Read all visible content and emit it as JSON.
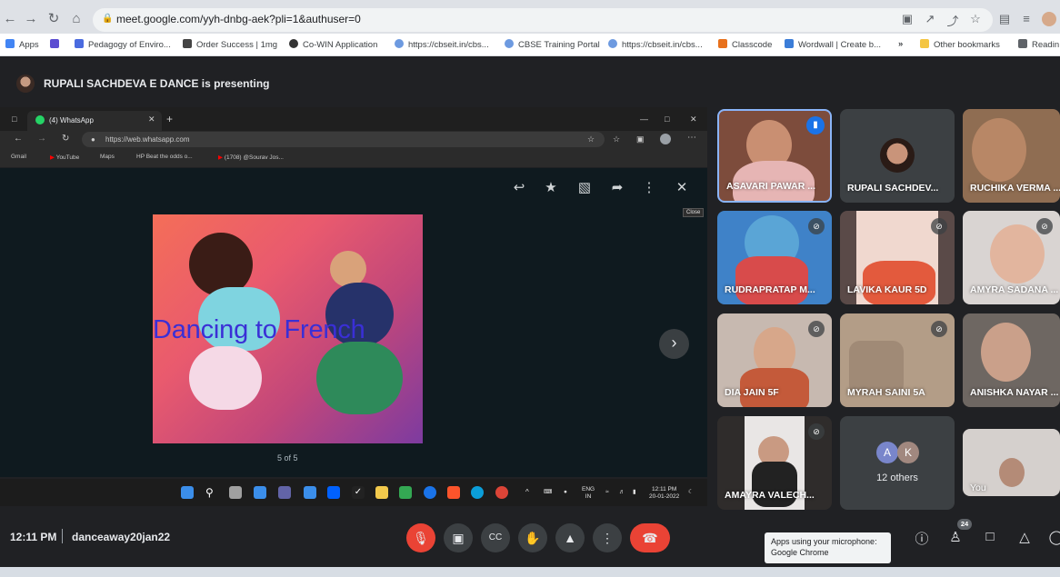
{
  "browser": {
    "url": "meet.google.com/yyh-dnbg-aek?pli=1&authuser=0",
    "bookmarks": [
      {
        "label": "Apps",
        "color": "#4285f4"
      },
      {
        "label": "",
        "color": "#5b4dd1"
      },
      {
        "label": "Pedagogy of Enviro...",
        "color": "#4a6bdf"
      },
      {
        "label": "Order Success | 1mg",
        "color": "#444444"
      },
      {
        "label": "Co-WIN Application",
        "color": "#333333"
      },
      {
        "label": "https://cbseit.in/cbs...",
        "color": "#6d9ae0"
      },
      {
        "label": "CBSE Training Portal",
        "color": "#6d9ae0"
      },
      {
        "label": "https://cbseit.in/cbs...",
        "color": "#6d9ae0"
      },
      {
        "label": "Classcode",
        "color": "#e8711c"
      },
      {
        "label": "Wordwall | Create b...",
        "color": "#3b7dd8"
      },
      {
        "label": "Other bookmarks",
        "color": "#f4c542"
      },
      {
        "label": "Readin",
        "color": "#5f6368"
      }
    ]
  },
  "meet": {
    "presenting_text": "RUPALI SACHDEVA E DANCE is presenting",
    "time": "12:11 PM",
    "meeting_code": "danceaway20jan22",
    "participants_count": "24",
    "mic_toast_line1": "Apps using your microphone:",
    "mic_toast_line2": "Google Chrome"
  },
  "shared_screen": {
    "tab_title": "(4) WhatsApp",
    "url": "https://web.whatsapp.com",
    "bookmarks": [
      "Gmail",
      "YouTube",
      "Maps",
      "HP Beat the odds o...",
      "(1708) @Sourav Jos..."
    ],
    "close_tooltip": "Close",
    "image_text": "Dancing to French",
    "counter": "5 of 5",
    "tray_lang1": "ENG",
    "tray_lang2": "IN",
    "tray_time": "12:11 PM",
    "tray_date": "20-01-2022"
  },
  "tiles": [
    {
      "name": "ASAVARI PAWAR ...",
      "muted": false
    },
    {
      "name": "RUPALI SACHDEV...",
      "muted": false
    },
    {
      "name": "RUCHIKA VERMA ...",
      "muted": false
    },
    {
      "name": "RUDRAPRATAP M...",
      "muted": true
    },
    {
      "name": "LAVIKA KAUR 5D",
      "muted": true
    },
    {
      "name": "AMYRA SADANA ...",
      "muted": true
    },
    {
      "name": "DIA JAIN 5F",
      "muted": true
    },
    {
      "name": "MYRAH SAINI 5A",
      "muted": true
    },
    {
      "name": "ANISHKA NAYAR ...",
      "muted": true
    },
    {
      "name": "AMAYRA VALECH...",
      "muted": true
    },
    {
      "name": "12 others",
      "muted": false
    },
    {
      "name": "You",
      "muted": false
    }
  ],
  "others_initials": [
    "A",
    "K"
  ],
  "colors": {
    "red": "#ea4335",
    "tile": "#3c4043",
    "bg": "#202124"
  }
}
